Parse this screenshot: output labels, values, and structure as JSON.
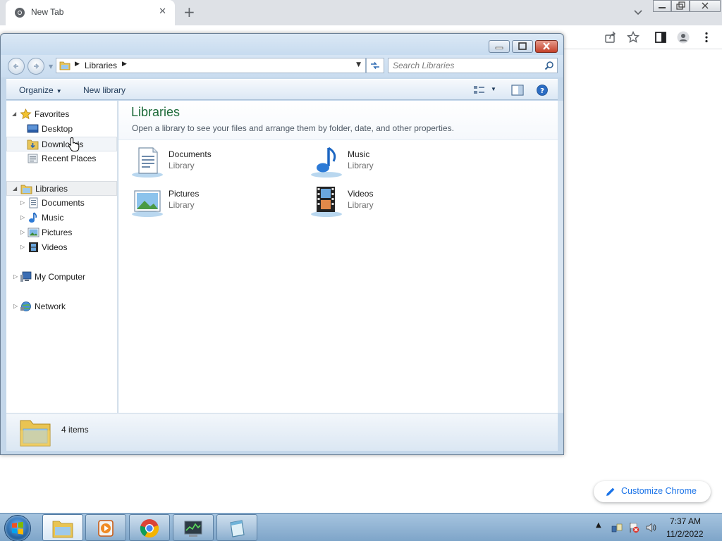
{
  "browser": {
    "tab_title": "New Tab",
    "customize_label": "Customize Chrome"
  },
  "explorer": {
    "breadcrumb": "Libraries",
    "search_placeholder": "Search Libraries",
    "commands": {
      "organize": "Organize",
      "new_library": "New library"
    },
    "nav": {
      "favorites": "Favorites",
      "desktop": "Desktop",
      "downloads": "Downloads",
      "recent_places": "Recent Places",
      "libraries": "Libraries",
      "documents": "Documents",
      "music": "Music",
      "pictures": "Pictures",
      "videos": "Videos",
      "my_computer": "My Computer",
      "network": "Network"
    },
    "content": {
      "title": "Libraries",
      "subtitle": "Open a library to see your files and arrange them by folder, date, and other properties.",
      "items": [
        {
          "name": "Documents",
          "type": "Library",
          "icon": "documents-library-icon"
        },
        {
          "name": "Music",
          "type": "Library",
          "icon": "music-library-icon"
        },
        {
          "name": "Pictures",
          "type": "Library",
          "icon": "pictures-library-icon"
        },
        {
          "name": "Videos",
          "type": "Library",
          "icon": "videos-library-icon"
        }
      ]
    },
    "details": {
      "count": "4 items"
    }
  },
  "taskbar": {
    "clock_time": "7:37 AM",
    "clock_date": "11/2/2022"
  },
  "colors": {
    "accent_title": "#1e6b3a",
    "chrome_link": "#1a73e8",
    "taskbar": "#8fb2d4"
  }
}
